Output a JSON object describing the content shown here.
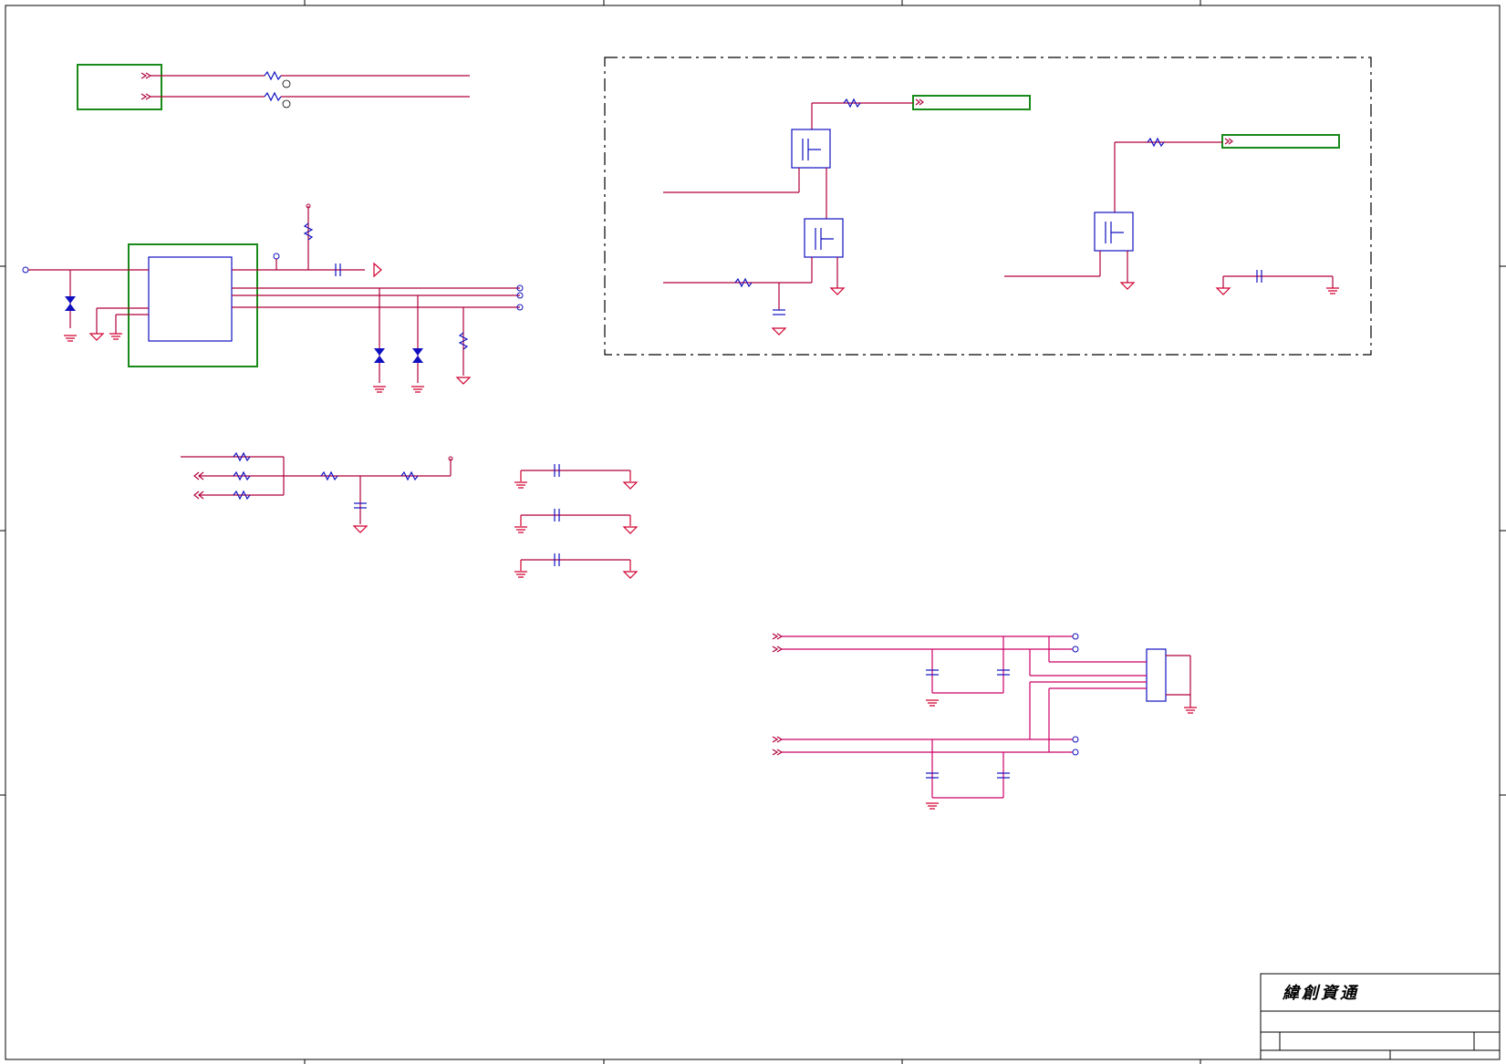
{
  "title_block": {
    "company": "緯創資通"
  },
  "colors": {
    "wire": "#b0003a",
    "component": "#1010c0",
    "block_outline": "#1a8a1a",
    "ground": "#d00030",
    "frame": "#000000"
  }
}
